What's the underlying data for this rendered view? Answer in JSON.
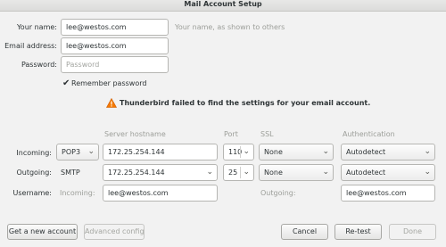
{
  "window": {
    "title": "Mail Account Setup"
  },
  "form": {
    "name_label": "Your name:",
    "name_value": "lee@westos.com",
    "name_hint": "Your name, as shown to others",
    "email_label": "Email address:",
    "email_value": "lee@westos.com",
    "password_label": "Password:",
    "password_placeholder": "Password",
    "remember_check": "✔",
    "remember_label": "Remember password"
  },
  "warning": {
    "icon": "warning-triangle-icon",
    "text": "Thunderbird failed to find the settings for your email account."
  },
  "server": {
    "headers": {
      "hostname": "Server hostname",
      "port": "Port",
      "ssl": "SSL",
      "auth": "Authentication"
    },
    "incoming": {
      "label": "Incoming:",
      "protocol": "POP3",
      "hostname": "172.25.254.144",
      "port": "110",
      "ssl": "None",
      "auth": "Autodetect"
    },
    "outgoing": {
      "label": "Outgoing:",
      "protocol": "SMTP",
      "hostname": "172.25.254.144",
      "port": "25",
      "ssl": "None",
      "auth": "Autodetect"
    },
    "username": {
      "label": "Username:",
      "incoming_label": "Incoming:",
      "incoming_value": "lee@westos.com",
      "outgoing_label": "Outgoing:",
      "outgoing_value": "lee@westos.com"
    }
  },
  "buttons": {
    "new_account": "Get a new account",
    "advanced": "Advanced config",
    "cancel": "Cancel",
    "retest": "Re-test",
    "done": "Done"
  },
  "glyphs": {
    "dropdown": "⌄"
  }
}
